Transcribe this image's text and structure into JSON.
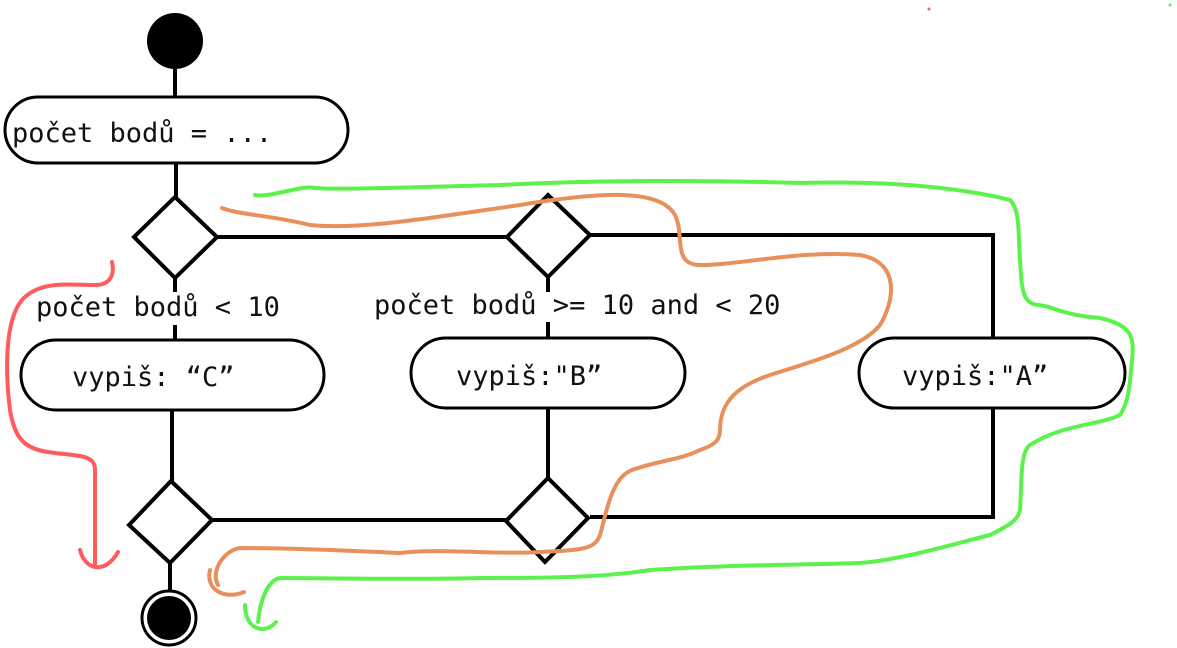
{
  "diagram": {
    "type": "activity-diagram",
    "start_node": "start",
    "end_node": "end",
    "nodes": {
      "init": {
        "label": "počet bodů = ..."
      },
      "print_c": {
        "label": "vypiš: “C”"
      },
      "print_b": {
        "label": "vypiš:\"B”"
      },
      "print_a": {
        "label": "vypiš:\"A”"
      }
    },
    "conditions": {
      "lt10": "počet bodů < 10",
      "between": "počet bodů >= 10 and < 20"
    },
    "annotations": {
      "path_c_color": "#ff5c5c",
      "path_b_color": "#e8905c",
      "path_a_color": "#5cf24c"
    }
  }
}
